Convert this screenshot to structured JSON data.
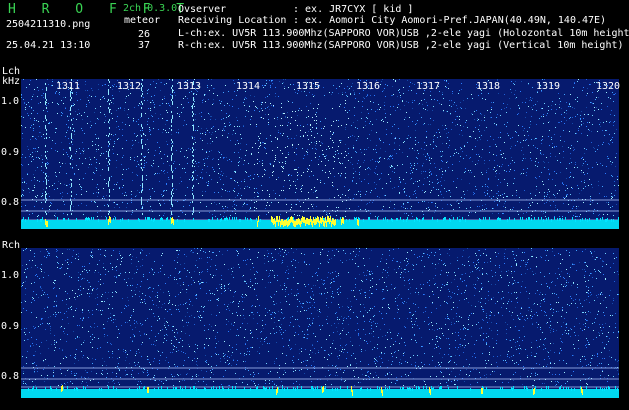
{
  "header": {
    "app_title": "H R O F F T",
    "version": "2ch 0.3.0",
    "mode": "meteor",
    "filename": "2504211310.png",
    "datetime": "25.04.21 13:10",
    "count_l": "26",
    "count_r": "37",
    "observer_label": "Ovserver",
    "observer_value": ": ex. JR7CYX [ kid ]",
    "location_label": "Receiving Location",
    "location_value": ": ex. Aomori City Aomori-Pref.JAPAN(40.49N, 140.47E)",
    "lch_info": "L-ch:ex. UV5R 113.900Mhz(SAPPORO VOR)USB ,2-ele yagi (Holozontal 10m height)",
    "rch_info": "R-ch:ex. UV5R 113.900Mhz(SAPPORO VOR)USB ,2-ele yagi (Vertical 10m height)"
  },
  "lch": {
    "label": "Lch",
    "unit": "kHz",
    "yticks": [
      "1.0",
      "0.9",
      "0.8"
    ],
    "xticks": [
      "1311",
      "1312",
      "1313",
      "1314",
      "1315",
      "1316",
      "1317",
      "1318",
      "1319",
      "1320"
    ]
  },
  "rch": {
    "label": "Rch",
    "yticks": [
      "1.0",
      "0.9",
      "0.8"
    ]
  },
  "colors": {
    "background": "#000000",
    "waterfall_bg": "#061a6e",
    "baseline": "#00e5ff",
    "meteor_head": "#ffff33",
    "label_green": "#39d353"
  }
}
